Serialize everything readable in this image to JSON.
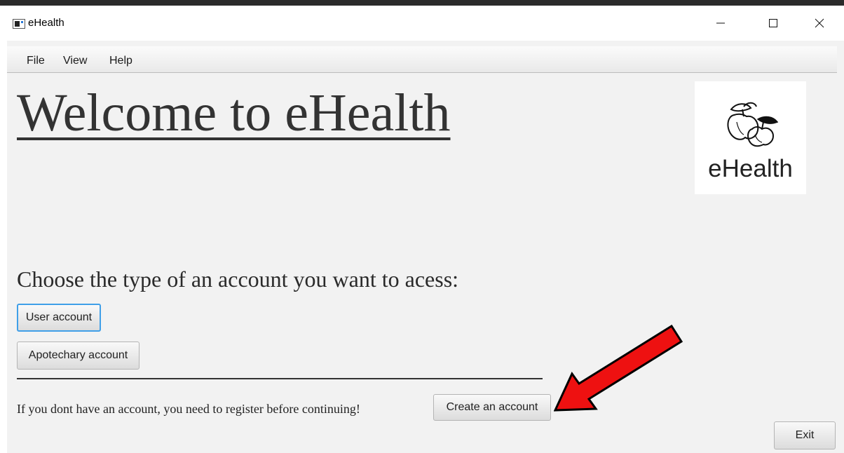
{
  "window": {
    "title": "eHealth",
    "icon": "app-window-icon",
    "controls": [
      "minimize-icon",
      "maximize-icon",
      "close-icon"
    ]
  },
  "menubar": {
    "items": [
      {
        "label": "File"
      },
      {
        "label": "View"
      },
      {
        "label": "Help"
      }
    ]
  },
  "main": {
    "heading": "Welcome to eHealth",
    "logo_text": "eHealth",
    "logo_icon": "apples-icon",
    "choose_prompt": "Choose the type of an account you want to acess:",
    "user_account_label": "User account",
    "apotechary_account_label": "Apotechary account",
    "register_text": "If you dont have an account, you need to register before continuing!",
    "create_account_label": "Create an account",
    "exit_label": "Exit"
  },
  "annotation": {
    "icon": "red-arrow-icon",
    "color": "#ee1111"
  },
  "colors": {
    "focus_border": "#3f9fe8",
    "background": "#f2f2f2"
  }
}
